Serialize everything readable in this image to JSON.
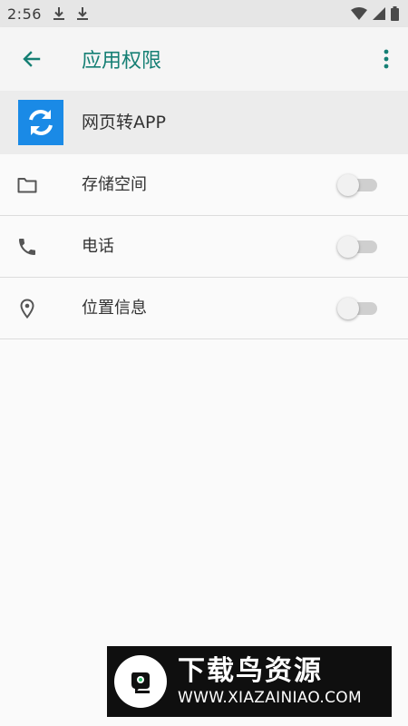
{
  "status_bar": {
    "time": "2:56",
    "icons": [
      "download-icon",
      "download-icon",
      "wifi-icon",
      "signal-icon",
      "battery-icon"
    ]
  },
  "app_bar": {
    "title": "应用权限",
    "back_icon": "arrow-left-icon",
    "menu_icon": "more-vert-icon",
    "accent_color": "#157f74"
  },
  "app_header": {
    "name": "网页转APP",
    "logo_icon": "sync-icon",
    "logo_color": "#1a8ae6"
  },
  "permissions": [
    {
      "label": "存储空间",
      "icon": "folder-icon",
      "enabled": false
    },
    {
      "label": "电话",
      "icon": "phone-icon",
      "enabled": false
    },
    {
      "label": "位置信息",
      "icon": "location-pin-icon",
      "enabled": false
    }
  ],
  "watermark": {
    "title": "下载鸟资源",
    "url": "WWW.XIAZAINIAO.COM"
  }
}
